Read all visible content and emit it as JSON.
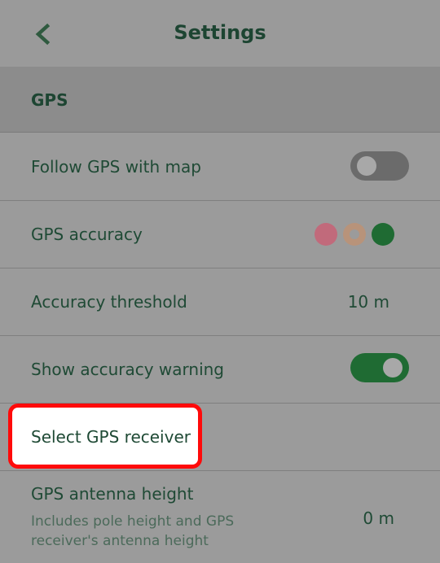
{
  "header": {
    "title": "Settings",
    "back_icon": "chevron-left-icon"
  },
  "section": {
    "title": "GPS"
  },
  "rows": {
    "follow_gps": {
      "label": "Follow GPS with map",
      "toggle": "off"
    },
    "gps_accuracy": {
      "label": "GPS accuracy",
      "indicator_colors": [
        "#c16a7b",
        "#b8937a",
        "#1f6b33"
      ]
    },
    "accuracy_threshold": {
      "label": "Accuracy threshold",
      "value": "10 m"
    },
    "accuracy_warning": {
      "label": "Show accuracy warning",
      "toggle": "on"
    },
    "select_receiver": {
      "label": "Select GPS receiver"
    },
    "antenna_height": {
      "label": "GPS antenna height",
      "description_line1": "Includes pole height and GPS",
      "description_line2": "receiver's antenna height",
      "value": "0 m"
    }
  },
  "colors": {
    "accent": "#1f6b33",
    "highlight_border": "#ff0a0a",
    "text": "#1f4a35"
  }
}
